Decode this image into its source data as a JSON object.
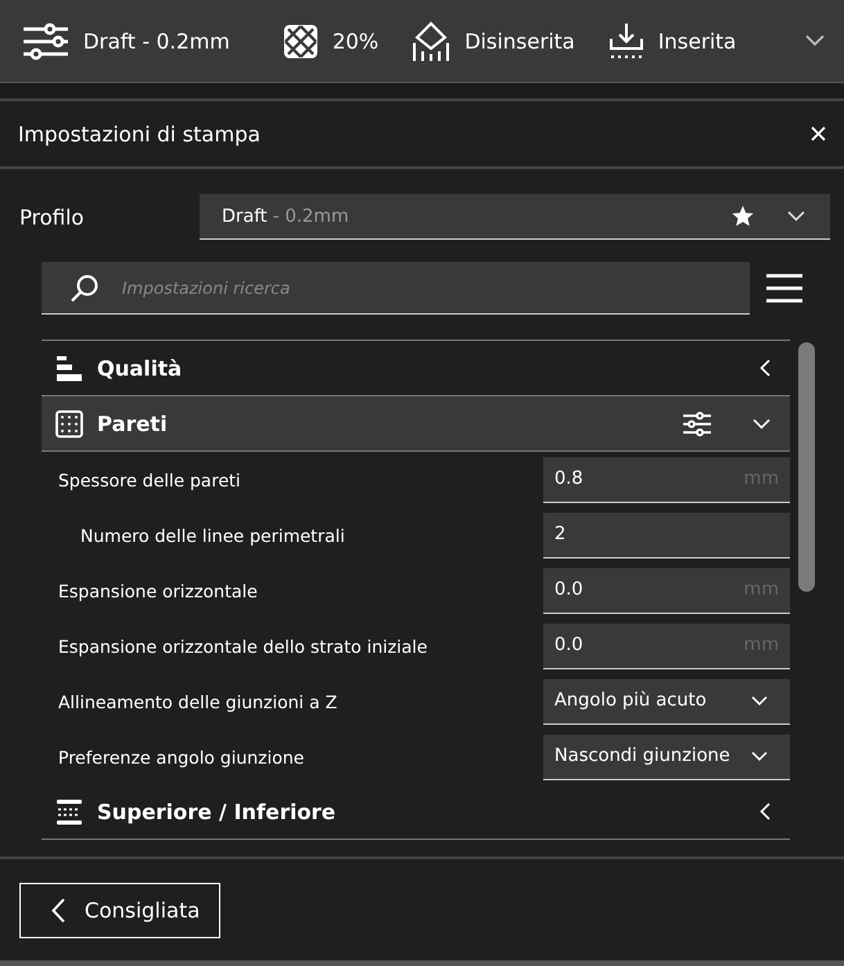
{
  "toolbar": {
    "items": [
      {
        "kind": "profile",
        "label": "Draft - 0.2mm"
      },
      {
        "kind": "infill",
        "label": "20%"
      },
      {
        "kind": "support",
        "label": "Disinserita"
      },
      {
        "kind": "adhesion",
        "label": "Inserita"
      }
    ]
  },
  "panel": {
    "title": "Impostazioni di stampa"
  },
  "profile": {
    "label": "Profilo",
    "name": "Draft",
    "detail": "- 0.2mm"
  },
  "search": {
    "placeholder": "Impostazioni ricerca"
  },
  "sections": [
    {
      "kind": "quality",
      "title": "Qualità",
      "expanded": false
    },
    {
      "kind": "walls",
      "title": "Pareti",
      "expanded": true,
      "settings": [
        {
          "kind": "number",
          "label": "Spessore delle pareti",
          "value": "0.8",
          "unit": "mm",
          "children": [
            {
              "kind": "number",
              "label": "Numero delle linee perimetrali",
              "value": "2"
            }
          ]
        },
        {
          "kind": "number",
          "label": "Espansione orizzontale",
          "value": "0.0",
          "unit": "mm"
        },
        {
          "kind": "number",
          "label": "Espansione orizzontale dello strato iniziale",
          "value": "0.0",
          "unit": "mm"
        },
        {
          "kind": "dropdown",
          "label": "Allineamento delle giunzioni a Z",
          "value": "Angolo più acuto"
        },
        {
          "kind": "dropdown",
          "label": "Preferenze angolo giunzione",
          "value": "Nascondi giunzione"
        }
      ]
    },
    {
      "kind": "topbottom",
      "title": "Superiore / Inferiore",
      "expanded": false
    }
  ],
  "footer": {
    "button": "Consigliata"
  }
}
